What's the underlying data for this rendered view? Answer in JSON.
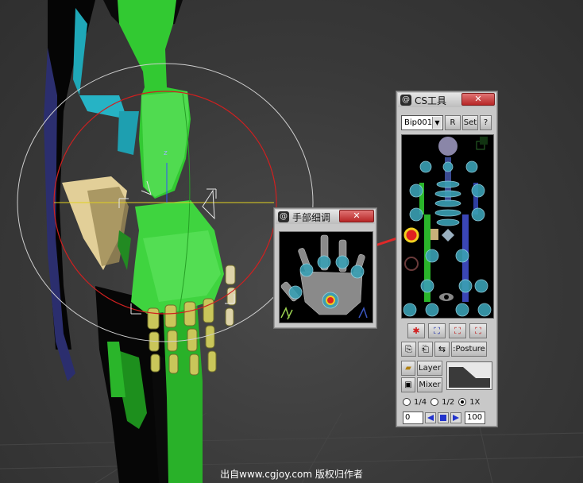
{
  "cs_window": {
    "title": "CS工具",
    "close_glyph": "✕",
    "biped_name": "Bip001",
    "r_label": "R",
    "set_label": "Set",
    "help_label": "?",
    "posture_label": ":Posture",
    "layer_label": "Layer",
    "mixer_label": "Mixer",
    "speed_options": [
      {
        "label": "1/4",
        "selected": false
      },
      {
        "label": "1/2",
        "selected": false
      },
      {
        "label": "1X",
        "selected": true
      }
    ],
    "frame_start": "0",
    "frame_end": "100"
  },
  "hand_window": {
    "title": "手部细调",
    "close_glyph": "✕"
  },
  "watermark": "出自www.cgjoy.com 版权归作者",
  "colors": {
    "bone_green": "#3bc43b",
    "finger_yellow": "#c9c65a",
    "gizmo_red": "#d02020",
    "selection_white": "#e6e6e6",
    "arrow_red": "#e02828"
  }
}
